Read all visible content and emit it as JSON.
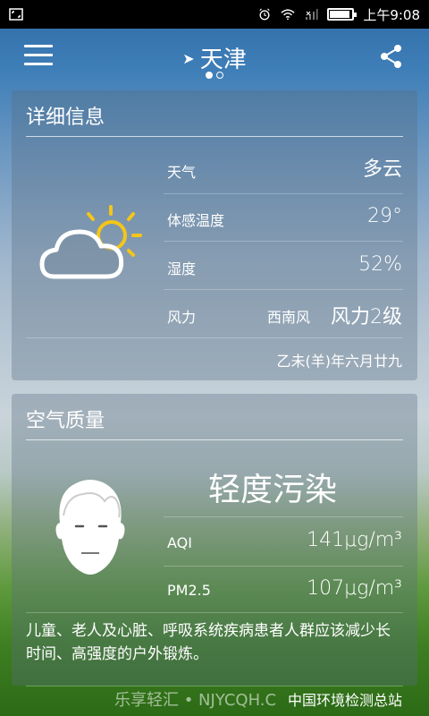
{
  "status_bar": {
    "time": "上午9:08"
  },
  "header": {
    "city": "天津",
    "page_indicator": {
      "count": 2,
      "active": 0
    }
  },
  "detail": {
    "title": "详细信息",
    "weather_label": "天气",
    "weather_value": "多云",
    "feels_label": "体感温度",
    "feels_value": "29°",
    "humidity_label": "湿度",
    "humidity_value": "52%",
    "wind_label": "风力",
    "wind_direction": "西南风",
    "wind_value": "风力2级",
    "lunar_date": "乙未(羊)年六月廿九"
  },
  "air": {
    "title": "空气质量",
    "level": "轻度污染",
    "aqi_label": "AQI",
    "aqi_value": "141μg/m³",
    "pm25_label": "PM2.5",
    "pm25_value": "107μg/m³",
    "advice": "儿童、老人及心脏、呼吸系统疾病患者人群应该减少长时间、高强度的户外锻炼。"
  },
  "footer": {
    "watermark": "乐享轻汇 • NJYCQH.C",
    "source": "中国环境检测总站"
  },
  "icons": {
    "menu": "menu-icon",
    "share": "share-icon",
    "location": "location-arrow-icon",
    "weather": "partly-cloudy-icon",
    "face": "face-mask-icon"
  }
}
